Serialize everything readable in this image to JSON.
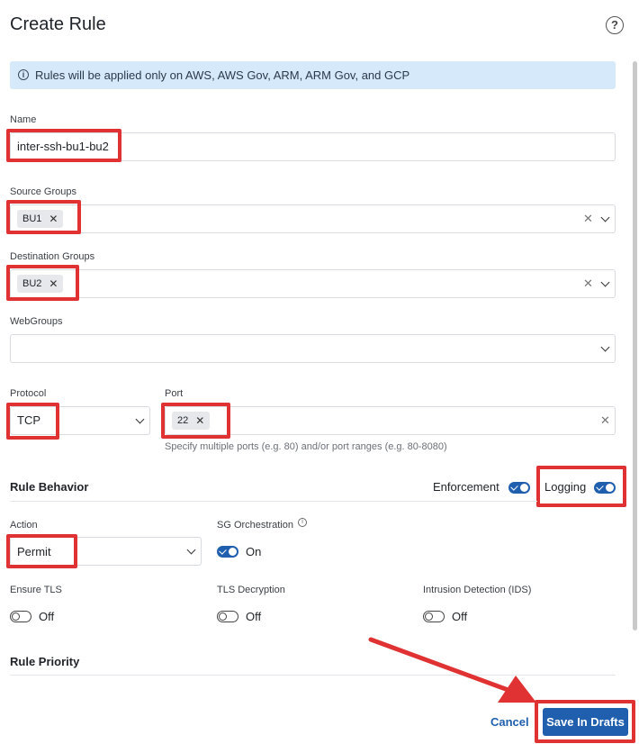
{
  "header": {
    "title": "Create Rule",
    "help_icon": "question-circle-icon"
  },
  "info_banner": {
    "text": "Rules will be applied only on AWS, AWS Gov, ARM, ARM Gov, and GCP",
    "icon": "info-icon"
  },
  "form": {
    "name": {
      "label": "Name",
      "value": "inter-ssh-bu1-bu2"
    },
    "source_groups": {
      "label": "Source Groups",
      "chips": [
        "BU1"
      ]
    },
    "destination_groups": {
      "label": "Destination Groups",
      "chips": [
        "BU2"
      ]
    },
    "webgroups": {
      "label": "WebGroups",
      "value": ""
    },
    "protocol": {
      "label": "Protocol",
      "value": "TCP"
    },
    "port": {
      "label": "Port",
      "chips": [
        "22"
      ],
      "hint": "Specify multiple ports (e.g. 80) and/or port ranges (e.g. 80-8080)"
    }
  },
  "rule_behavior": {
    "title": "Rule Behavior",
    "enforcement": {
      "label": "Enforcement",
      "on": true
    },
    "logging": {
      "label": "Logging",
      "on": true
    },
    "action": {
      "label": "Action",
      "value": "Permit"
    },
    "sg_orchestration": {
      "label": "SG Orchestration",
      "state": "On"
    },
    "ensure_tls": {
      "label": "Ensure TLS",
      "state": "Off"
    },
    "tls_decryption": {
      "label": "TLS Decryption",
      "state": "Off"
    },
    "ids": {
      "label": "Intrusion Detection (IDS)",
      "state": "Off"
    }
  },
  "rule_priority": {
    "title": "Rule Priority"
  },
  "footer": {
    "cancel_label": "Cancel",
    "save_label": "Save In Drafts"
  },
  "colors": {
    "primary": "#1f5fae",
    "highlight": "#e03232",
    "info_bg": "#d6e9fb"
  }
}
